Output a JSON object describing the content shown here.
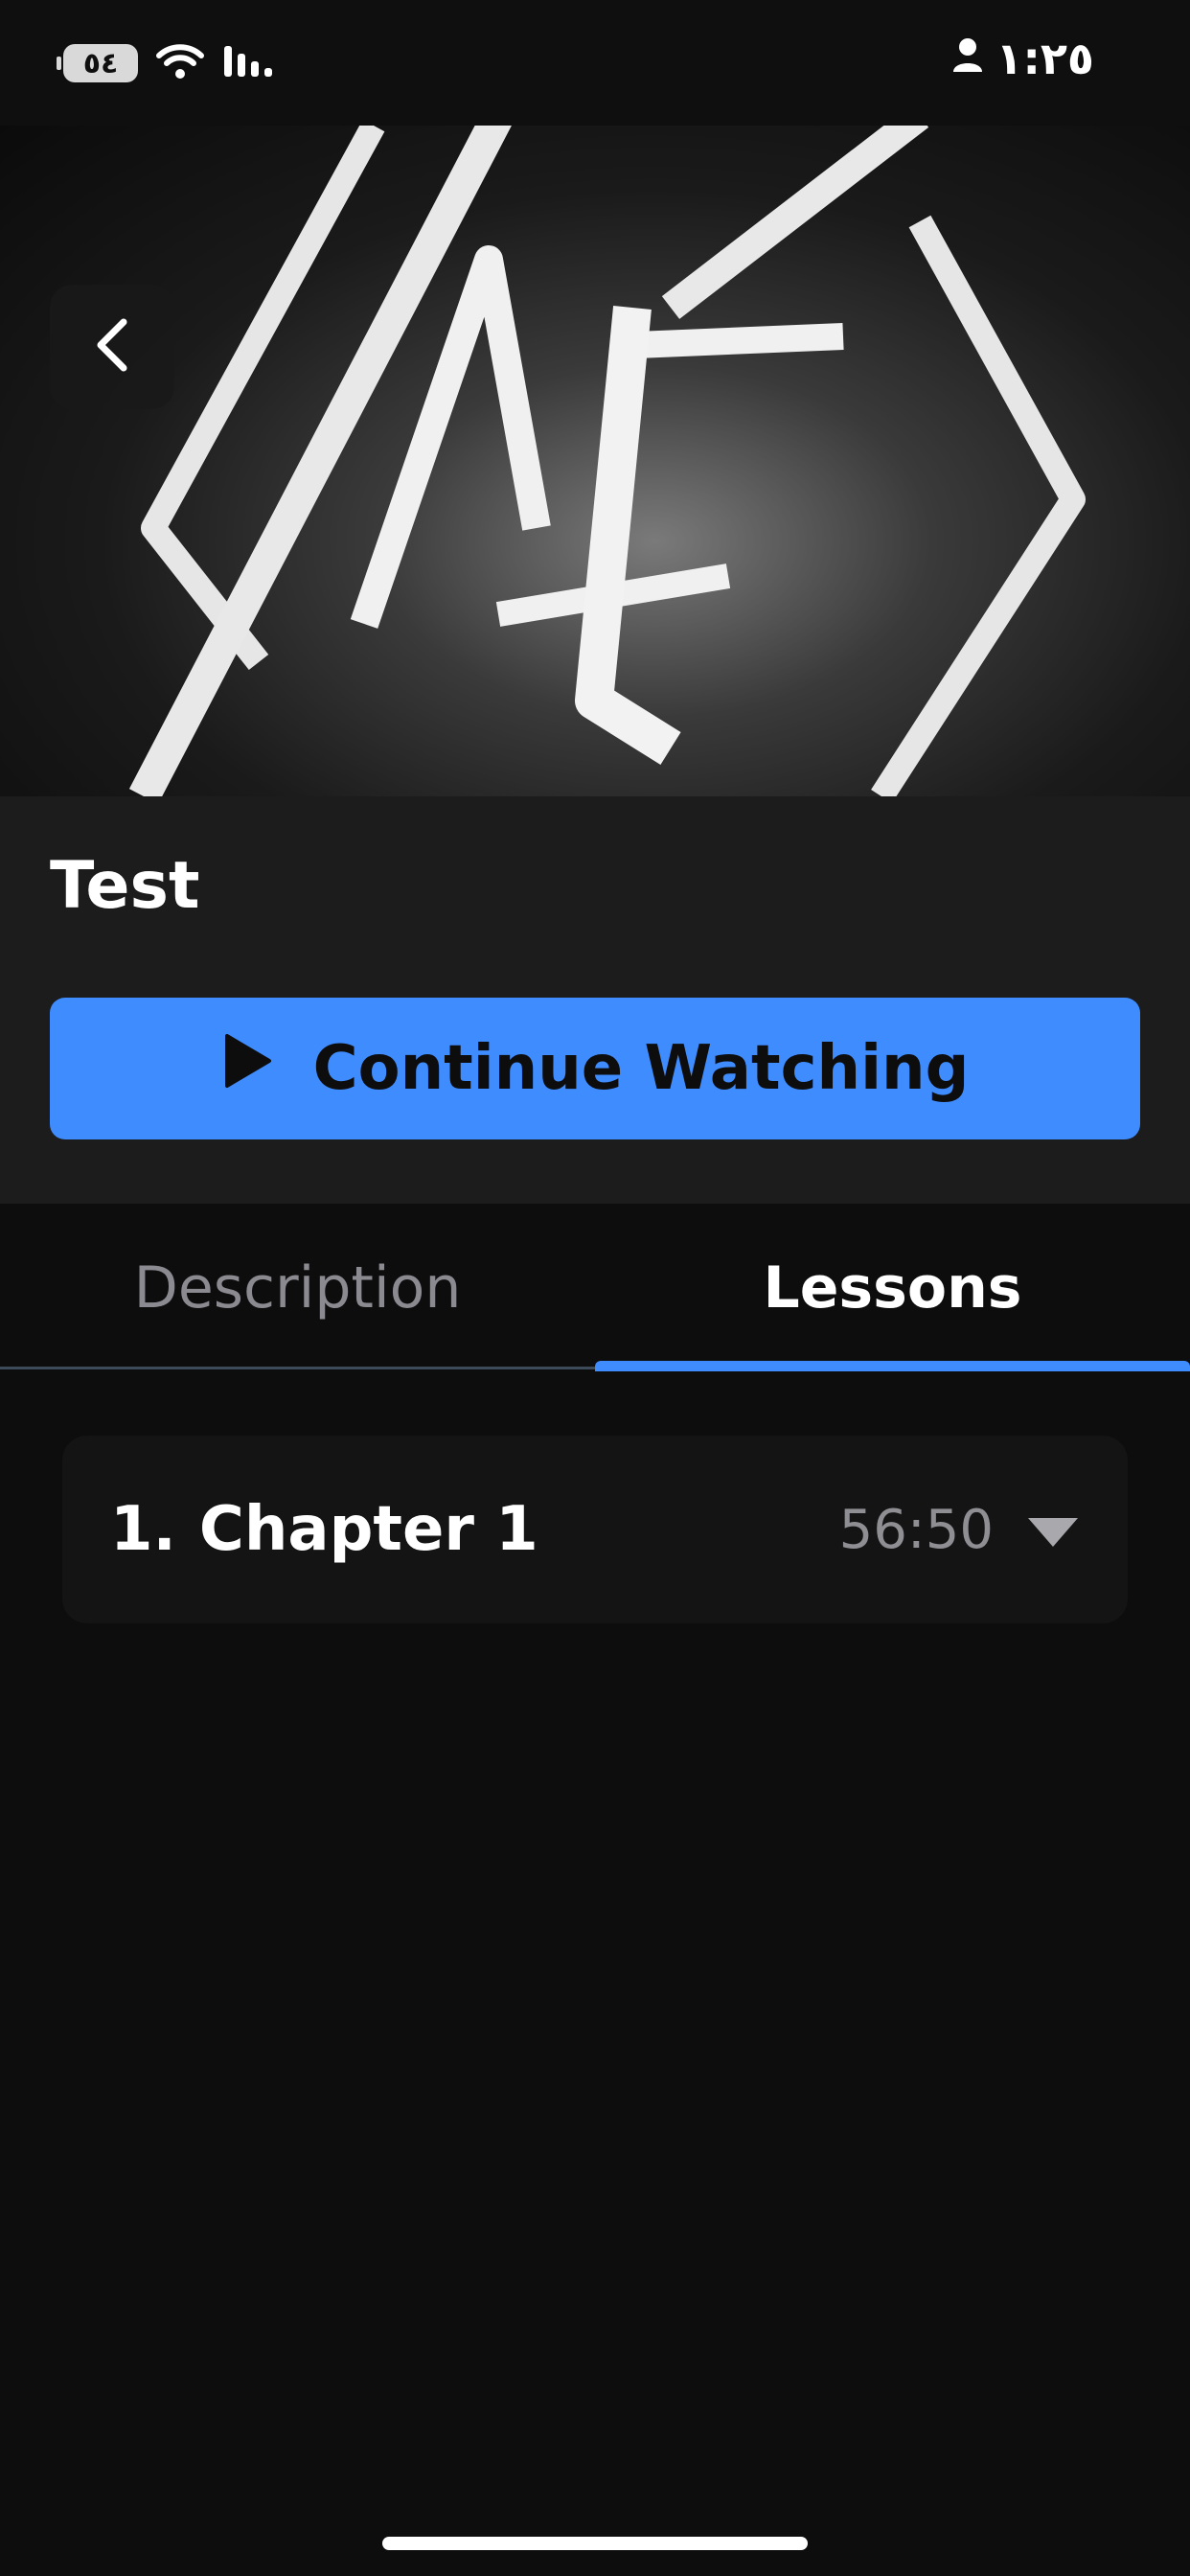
{
  "status_bar": {
    "battery_level": "٥٤",
    "time": "١:٢٥",
    "icons": [
      "wifi-icon",
      "signal-icon",
      "person-icon"
    ]
  },
  "hero": {
    "logo_text": "AF",
    "back_icon": "chevron-left-icon"
  },
  "course": {
    "title": "Test",
    "continue_label": "Continue Watching",
    "continue_icon": "play-icon"
  },
  "tabs": [
    {
      "label": "Description",
      "active": false
    },
    {
      "label": "Lessons",
      "active": true
    }
  ],
  "chapters": [
    {
      "number": "1.",
      "title": "Chapter 1",
      "duration": "56:50",
      "expand_icon": "caret-down-icon"
    }
  ],
  "colors": {
    "accent": "#3f8cff",
    "background": "#0d0d0d",
    "panel": "#1c1c1c",
    "card": "#141414"
  }
}
